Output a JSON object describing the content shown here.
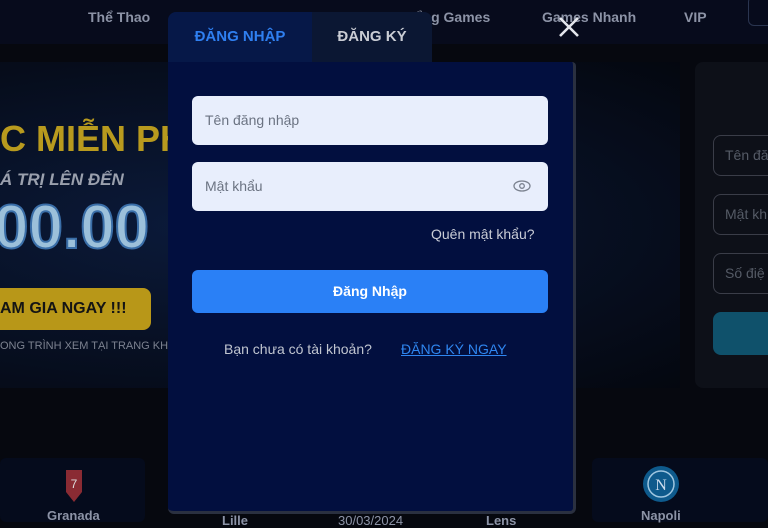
{
  "nav": {
    "items": [
      "Thể Thao",
      "ổng Games",
      "Games Nhanh",
      "VIP"
    ]
  },
  "banner": {
    "headline": "C MIỄN PH",
    "subline": "Á TRỊ LÊN ĐẾN",
    "amount": "00.00",
    "join_label": "AM GIA NGAY !!!",
    "footnote": "ONG TRÌNH XEM TẠI TRANG KH"
  },
  "side_form": {
    "username_placeholder": "Tên đă",
    "password_placeholder": "Mật kh",
    "phone_placeholder": "Số điệ"
  },
  "matches": {
    "teams": [
      "Granada",
      "Lille",
      "30/03/2024",
      "Lens",
      "Napoli"
    ]
  },
  "modal": {
    "tabs": [
      {
        "label": "ĐĂNG NHẬP",
        "active": true
      },
      {
        "label": "ĐĂNG KÝ",
        "active": false
      }
    ],
    "username_placeholder": "Tên đăng nhập",
    "password_placeholder": "Mật khẩu",
    "forgot_label": "Quên mật khẩu?",
    "login_label": "Đăng Nhập",
    "no_account_text": "Bạn chưa có tài khoản?",
    "register_link": "ĐĂNG KÝ NGAY",
    "accent": "#2a80f6"
  }
}
